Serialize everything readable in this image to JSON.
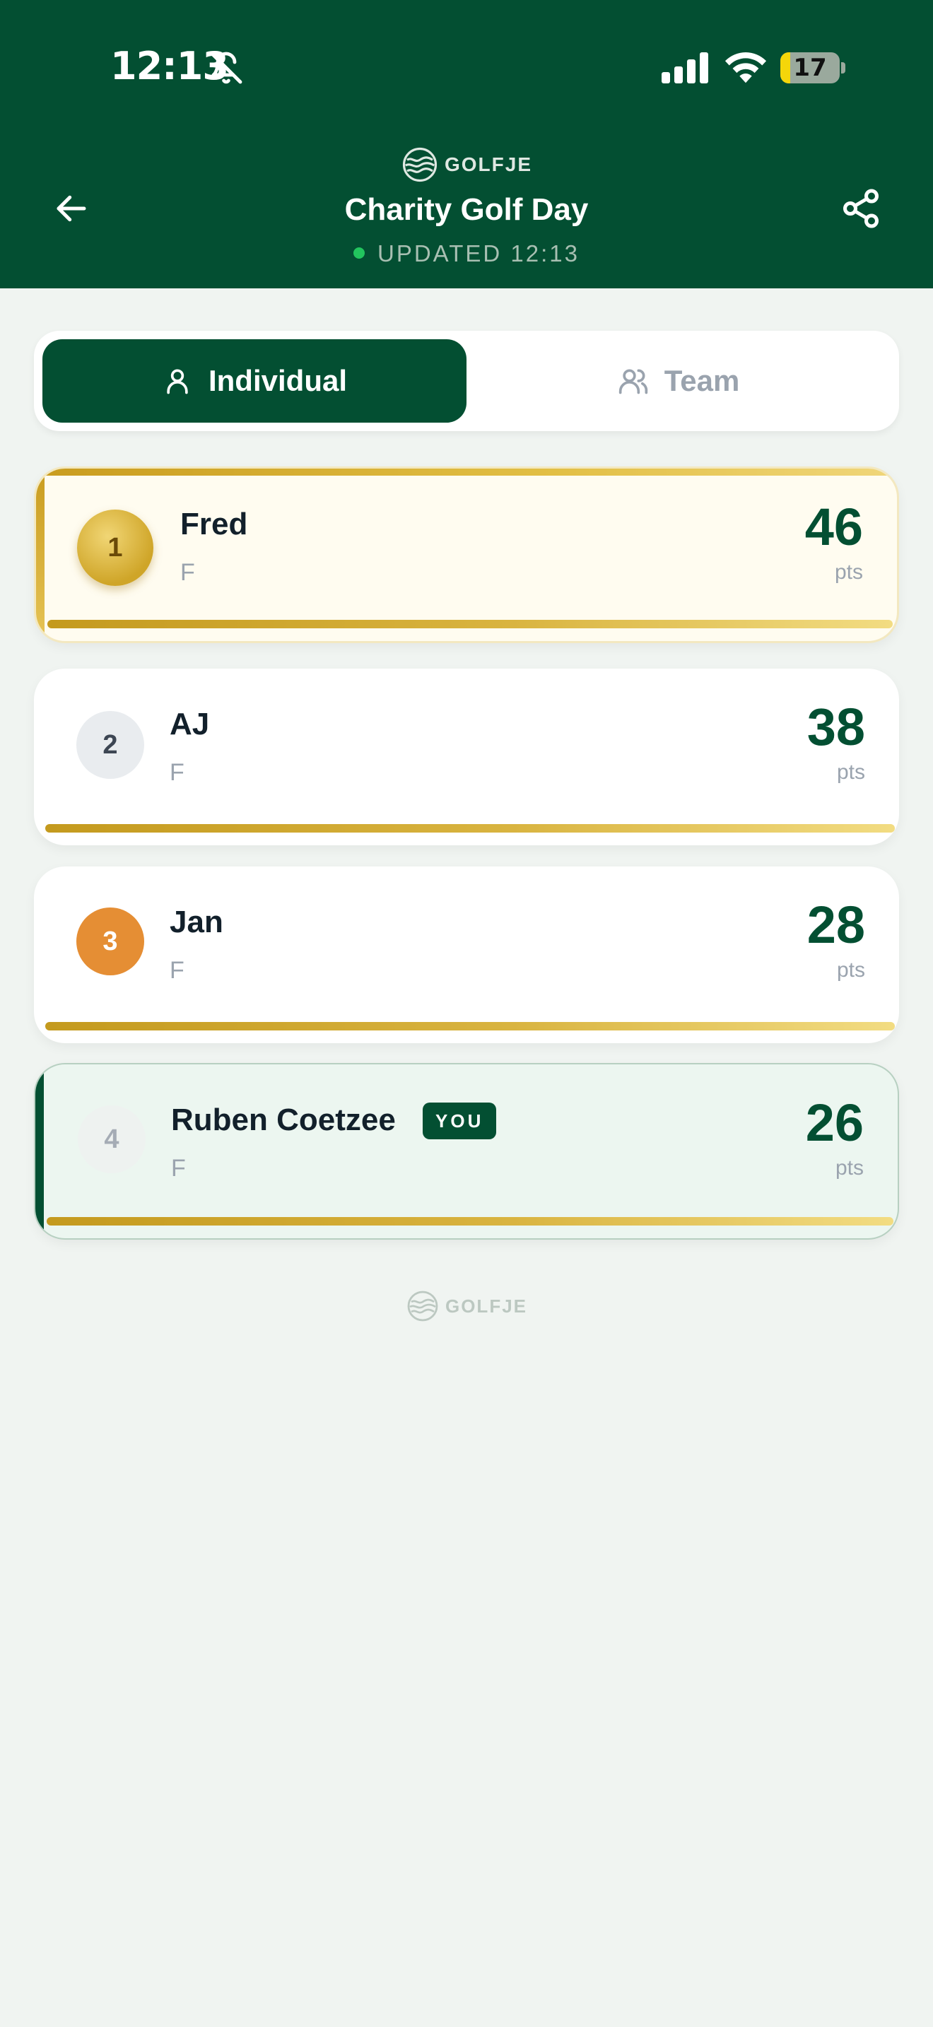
{
  "status_bar": {
    "time": "12:13",
    "battery_level": "17",
    "battery_fraction": 0.17,
    "icons": [
      "bell-off-icon",
      "signal-icon",
      "wifi-icon",
      "battery-icon"
    ]
  },
  "header": {
    "brand": "GOLFJE",
    "title": "Charity Golf Day",
    "updated": "UPDATED 12:13",
    "back_icon": "arrow-left-icon",
    "share_icon": "share-icon"
  },
  "tabs": [
    {
      "label": "Individual",
      "icon": "person-icon",
      "active": true
    },
    {
      "label": "Team",
      "icon": "people-icon",
      "active": false
    }
  ],
  "leaderboard": [
    {
      "rank": "1",
      "name": "Fred",
      "sub": "F",
      "points": "46",
      "unit": "pts"
    },
    {
      "rank": "2",
      "name": "AJ",
      "sub": "F",
      "points": "38",
      "unit": "pts"
    },
    {
      "rank": "3",
      "name": "Jan",
      "sub": "F",
      "points": "28",
      "unit": "pts"
    },
    {
      "rank": "4",
      "name": "Ruben Coetzee",
      "sub": "F",
      "points": "26",
      "unit": "pts",
      "badge": "YOU"
    }
  ],
  "footer": {
    "brand": "GOLFJE"
  },
  "colors": {
    "primary": "#034f32",
    "gold": "#cfa528",
    "bronze": "#e58e34",
    "silver": "#e9ecef",
    "background": "#f0f4f1",
    "live": "#22c55e"
  }
}
